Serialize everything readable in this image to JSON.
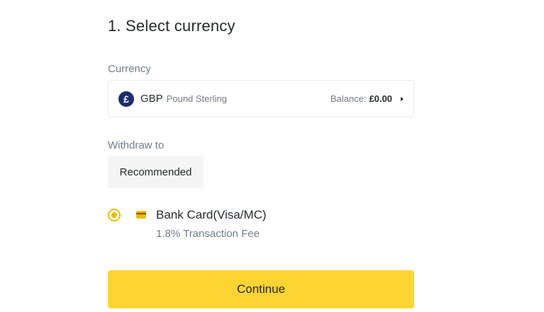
{
  "step": {
    "title": "1. Select currency"
  },
  "currency": {
    "label": "Currency",
    "icon_symbol": "£",
    "icon_name": "pound-sterling-icon",
    "code": "GBP",
    "name": "Pound Sterling",
    "balance_label": "Balance:",
    "balance_value": "£0.00"
  },
  "withdraw": {
    "label": "Withdraw to",
    "tab_label": "Recommended",
    "options": [
      {
        "title": "Bank Card(Visa/MC)",
        "subtitle": "1.8% Transaction Fee",
        "selected": true,
        "icon_name": "bank-card-icon"
      }
    ]
  },
  "actions": {
    "continue_label": "Continue"
  },
  "colors": {
    "accent": "#f0b90b",
    "button_bg": "#fcd535",
    "text_primary": "#1e2329",
    "text_secondary": "#707a8a",
    "icon_bg": "#1c2e6b"
  }
}
